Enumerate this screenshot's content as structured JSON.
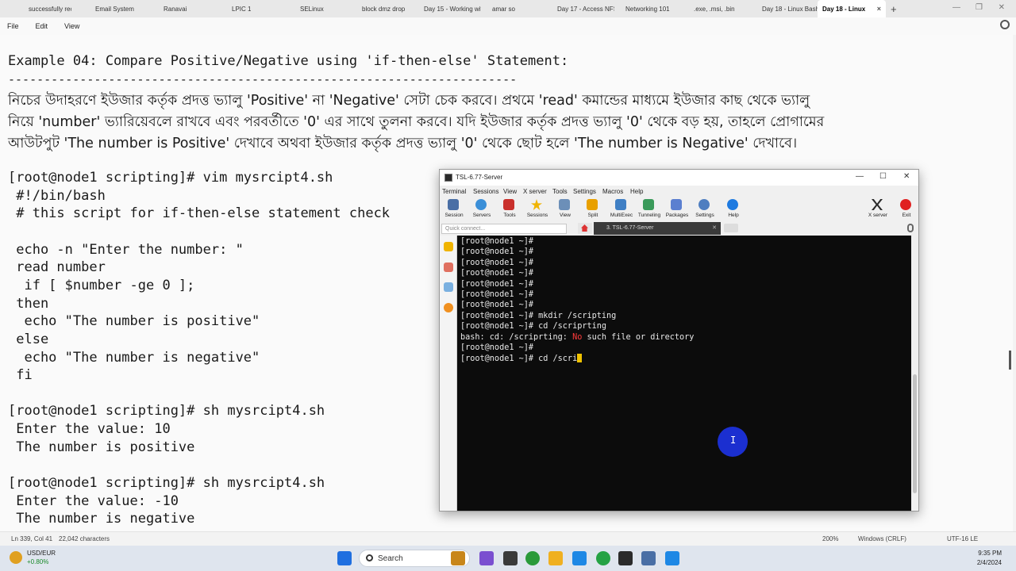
{
  "browser": {
    "tabs": [
      {
        "label": "successfully rec",
        "active": false
      },
      {
        "label": "Email System",
        "active": false
      },
      {
        "label": "Ranavai",
        "active": false
      },
      {
        "label": "LPIC 1",
        "active": false
      },
      {
        "label": "SELinux",
        "active": false
      },
      {
        "label": "block dmz drop",
        "active": false
      },
      {
        "label": "Day 15 - Working witl",
        "active": false
      },
      {
        "label": "amar so",
        "active": false
      },
      {
        "label": "Day 17 - Access NFS :",
        "active": false
      },
      {
        "label": "Networking 101",
        "active": false
      },
      {
        "label": ".exe, .msi, .bin",
        "active": false
      },
      {
        "label": "Day 18 - Linux Bash S",
        "active": false
      },
      {
        "label": "Day 18 - Linux",
        "active": true
      }
    ],
    "tab_close": "×",
    "new_tab": "+",
    "window_controls": {
      "minimize": "—",
      "maximize": "❐",
      "close": "✕"
    }
  },
  "menu": {
    "file": "File",
    "edit": "Edit",
    "view": "View"
  },
  "document": {
    "heading": "Example 04: Compare Positive/Negative using 'if-then-else' Statement:",
    "rule": "-----------------------------------------------------------------------",
    "bengali": [
      "নিচের উদাহরণে ইউজার কর্তৃক প্রদত্ত ভ্যালু 'Positive' না 'Negative' সেটা চেক করবে। প্রথমে 'read' কমান্ডের মাধ্যমে ইউজার কাছ থেকে ভ্যালু",
      "নিয়ে 'number' ভ্যারিয়েবলে রাখবে এবং পরবর্তীতে '0' এর সাথে তুলনা করবে। যদি ইউজার কর্তৃক প্রদত্ত ভ্যালু '0' থেকে বড় হয়, তাহলে প্রোগামের",
      "আউটপুট 'The number is Positive' দেখাবে অথবা ইউজার কর্তৃক প্রদত্ত ভ্যালু '0' থেকে ছোট হলে 'The number is Negative' দেখাবে।"
    ],
    "code": [
      "[root@node1 scripting]# vim mysrcipt4.sh",
      " #!/bin/bash",
      " # this script for if-then-else statement check",
      "",
      " echo -n \"Enter the number: \"",
      " read number",
      "  if [ $number -ge 0 ];",
      " then",
      "  echo \"The number is positive\"",
      " else",
      "  echo \"The number is negative\"",
      " fi",
      "",
      "[root@node1 scripting]# sh mysrcipt4.sh",
      " Enter the value: 10",
      " The number is positive",
      "",
      "[root@node1 scripting]# sh mysrcipt4.sh",
      " Enter the value: -10",
      " The number is negative"
    ]
  },
  "status": {
    "position": "Ln 339, Col 41",
    "chars": "22,042 characters",
    "zoom": "200%",
    "line_ending": "Windows (CRLF)",
    "encoding": "UTF-16 LE"
  },
  "moba": {
    "title": "TSL-6.77-Server",
    "window_controls": {
      "minimize": "—",
      "maximize": "☐",
      "close": "✕"
    },
    "menu": [
      "Terminal",
      "Sessions",
      "View",
      "X server",
      "Tools",
      "Settings",
      "Macros",
      "Help"
    ],
    "tools": [
      "Session",
      "Servers",
      "Tools",
      "Sessions",
      "View",
      "Split",
      "MultiExec",
      "Tunneling",
      "Packages",
      "Settings",
      "Help"
    ],
    "right_tools": [
      "X server",
      "Exit"
    ],
    "quick_connect": "Quick connect...",
    "session_tab": "3. TSL-6.77-Server",
    "session_tab_close": "✕",
    "terminal": {
      "prompt_lines": [
        "[root@node1 ~]#",
        "[root@node1 ~]#",
        "[root@node1 ~]#",
        "[root@node1 ~]#",
        "[root@node1 ~]#",
        "[root@node1 ~]#",
        "[root@node1 ~]#"
      ],
      "cmd1": "[root@node1 ~]# mkdir /scripting",
      "cmd2": "[root@node1 ~]# cd /scriprting",
      "err_pre": "bash: cd: /scriprting: ",
      "err_no": "No",
      "err_post": " such file or directory",
      "prompt_after": "[root@node1 ~]#",
      "current": "[root@node1 ~]# cd /scri"
    }
  },
  "taskbar": {
    "stock_name": "USD/EUR",
    "stock_change": "+0.80%",
    "search": "Search",
    "time": "9:35 PM",
    "date": "2/4/2024"
  }
}
